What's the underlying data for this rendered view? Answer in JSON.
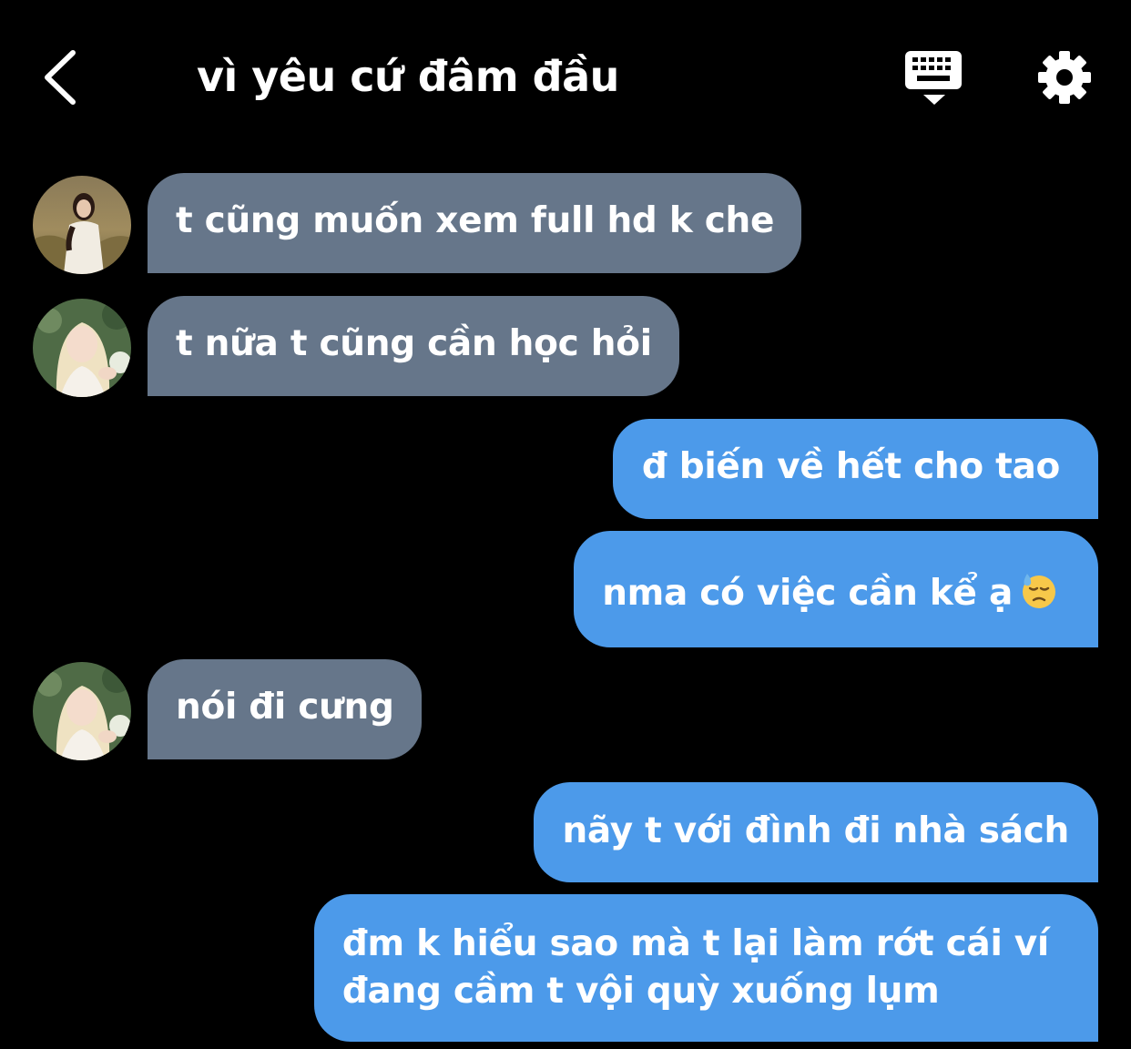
{
  "header": {
    "title": "vì yêu cứ đâm đầu",
    "back_icon": "chevron-left-icon",
    "keyboard_icon": "keyboard-dismiss-icon",
    "settings_icon": "gear-icon"
  },
  "colors": {
    "background": "#000000",
    "incoming_bubble": "#66768a",
    "outgoing_bubble": "#4c9aea",
    "text": "#ffffff"
  },
  "messages": [
    {
      "direction": "incoming",
      "avatar": "avatar-1",
      "text": "t cũng muốn xem full hd k che"
    },
    {
      "direction": "incoming",
      "avatar": "avatar-2",
      "text": "t nữa t cũng cần học hỏi"
    },
    {
      "direction": "outgoing",
      "text": "đ biến về hết cho tao"
    },
    {
      "direction": "outgoing",
      "text": "nma có việc cần kể ạ",
      "emoji": "downcast-sweat-face-emoji"
    },
    {
      "direction": "incoming",
      "avatar": "avatar-2",
      "text": "nói đi cưng"
    },
    {
      "direction": "outgoing",
      "text": "nãy t với đình đi nhà sách"
    },
    {
      "direction": "outgoing",
      "lines": [
        "đm k hiểu sao mà t lại làm rớt cái ví",
        "đang cầm t vội quỳ xuống lụm"
      ]
    }
  ]
}
